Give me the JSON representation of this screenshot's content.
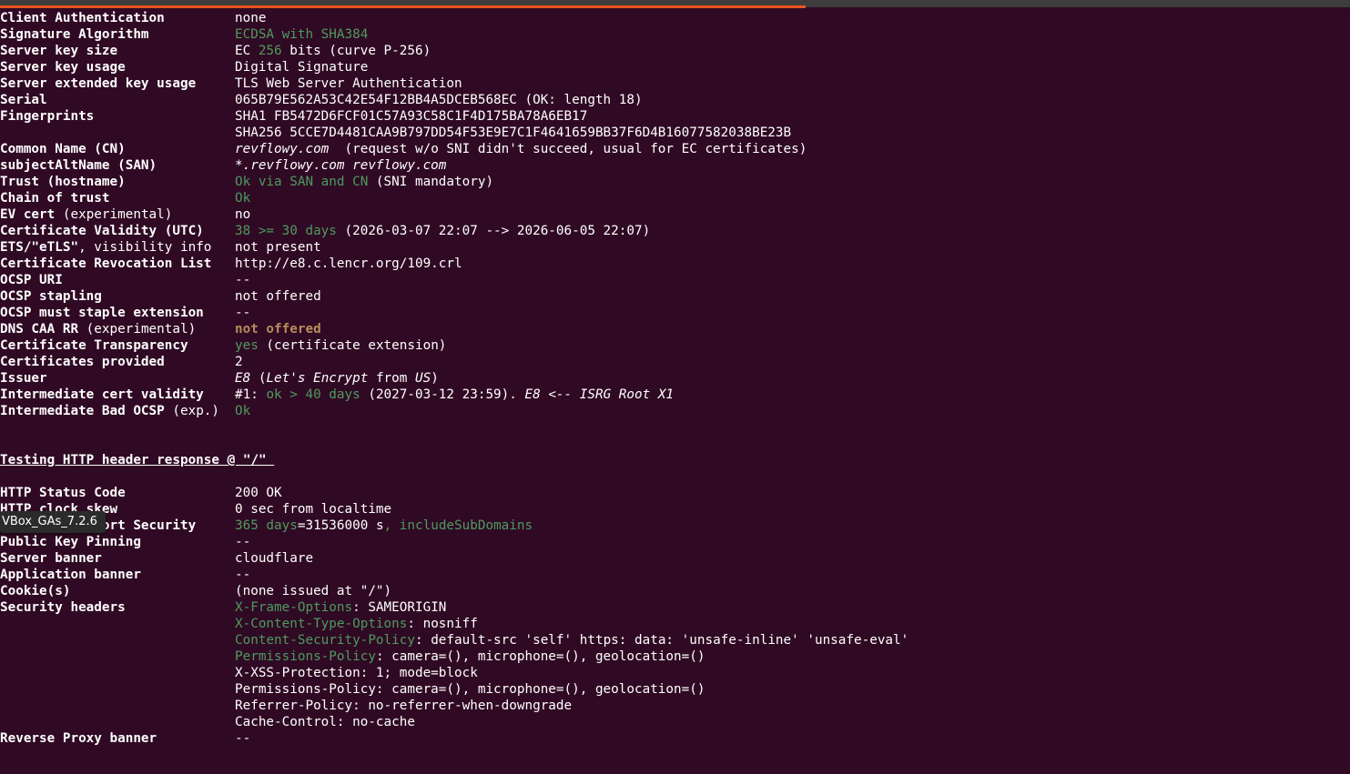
{
  "tooltip": "VBox_GAs_7.2.6",
  "rows": {
    "client_auth": {
      "label": "Client Authentication",
      "value": "none"
    },
    "sig_alg": {
      "label": "Signature Algorithm",
      "value": "ECDSA with SHA384"
    },
    "key_size": {
      "label": "Server key size",
      "v1": "EC ",
      "v2": "256",
      "v3": " bits (curve P-256)"
    },
    "key_usage": {
      "label": "Server key usage",
      "value": "Digital Signature"
    },
    "ext_key_usage": {
      "label": "Server extended key usage",
      "value": "TLS Web Server Authentication"
    },
    "serial": {
      "label": "Serial",
      "value": "065B79E562A53C42E54F12BB4A5DCEB568EC (OK: length 18)"
    },
    "fingerprints": {
      "label": "Fingerprints",
      "sha1": "SHA1 FB5472D6FCF01C57A93C58C1F4D175BA78A6EB17",
      "sha256": "SHA256 5CCE7D4481CAA9B797DD54F53E9E7C1F4641659BB37F6D4B16077582038BE23B"
    },
    "cn": {
      "label": "Common Name (CN)",
      "v1": "revflowy.com",
      "v2": "  (request w/o SNI didn't succeed, usual for EC certificates)"
    },
    "san": {
      "label": "subjectAltName (SAN)",
      "value": "*.revflowy.com revflowy.com"
    },
    "trust": {
      "label": "Trust (hostname)",
      "v1": "Ok via SAN and CN",
      "v2": " (SNI mandatory)"
    },
    "chain": {
      "label": "Chain of trust",
      "value": "Ok"
    },
    "ev": {
      "label1": "EV cert",
      "label2": " (experimental)",
      "value": "no"
    },
    "validity": {
      "label": "Certificate Validity (UTC)",
      "v1": "38 >= 30 days",
      "v2": " (2026-03-07 22:07 --> 2026-06-05 22:07)"
    },
    "ets": {
      "label1": "ETS/\"eTLS\"",
      "label2": ", visibility info",
      "value": "not present"
    },
    "crl": {
      "label": "Certificate Revocation List",
      "value": "http://e8.c.lencr.org/109.crl"
    },
    "ocsp_uri": {
      "label": "OCSP URI",
      "value": "--"
    },
    "ocsp_stapling": {
      "label": "OCSP stapling",
      "value": "not offered"
    },
    "ocsp_must": {
      "label": "OCSP must staple extension",
      "value": "--"
    },
    "dns_caa": {
      "label1": "DNS CAA RR",
      "label2": " (experimental)",
      "value": "not offered"
    },
    "ct": {
      "label": "Certificate Transparency",
      "v1": "yes",
      "v2": " (certificate extension)"
    },
    "certs_provided": {
      "label": "Certificates provided",
      "value": "2"
    },
    "issuer": {
      "label": "Issuer",
      "v1": "E8",
      "v2": " (",
      "v3": "Let's Encrypt",
      "v4": " from ",
      "v5": "US",
      "v6": ")"
    },
    "inter_validity": {
      "label": "Intermediate cert validity",
      "v1": "#1: ",
      "v2": "ok > 40 days",
      "v3": " (2027-03-12 23:59). ",
      "v4": "E8 <-- ISRG Root X1"
    },
    "inter_ocsp": {
      "label1": "Intermediate Bad OCSP",
      "label2": " (exp.)",
      "value": "Ok"
    }
  },
  "section_title": "Testing HTTP header response @ \"/\" ",
  "http": {
    "status": {
      "label": "HTTP Status Code",
      "value": "200 OK"
    },
    "clock": {
      "label": "HTTP clock skew",
      "value": "0 sec from localtime"
    },
    "hsts": {
      "label": "Strict Transport Security",
      "v1": "365 days",
      "v2": "=31536000 s",
      "v3": ", includeSubDomains"
    },
    "hpkp": {
      "label": "Public Key Pinning",
      "value": "--"
    },
    "server_banner": {
      "label": "Server banner",
      "value": "cloudflare"
    },
    "app_banner": {
      "label": "Application banner",
      "value": "--"
    },
    "cookies": {
      "label": "Cookie(s)",
      "value": "(none issued at \"/\")"
    },
    "sec_headers": {
      "label": "Security headers",
      "h1": {
        "name": "X-Frame-Options",
        "value": ": SAMEORIGIN"
      },
      "h2": {
        "name": "X-Content-Type-Options",
        "value": ": nosniff"
      },
      "h3": {
        "name": "Content-Security-Policy",
        "value": ": default-src 'self' https: data: 'unsafe-inline' 'unsafe-eval'"
      },
      "h4": {
        "name": "Permissions-Policy",
        "value": ": camera=(), microphone=(), geolocation=()"
      },
      "h5": "X-XSS-Protection: 1; mode=block",
      "h6": "Permissions-Policy: camera=(), microphone=(), geolocation=()",
      "h7": "Referrer-Policy: no-referrer-when-downgrade",
      "h8": "Cache-Control: no-cache"
    },
    "reverse_proxy": {
      "label": "Reverse Proxy banner",
      "value": "--"
    }
  },
  "colors": {
    "background": "#300a24",
    "green": "#4e9a5f",
    "amber": "#b78c5b",
    "accent": "#e95420"
  },
  "top_progress": 0.597
}
